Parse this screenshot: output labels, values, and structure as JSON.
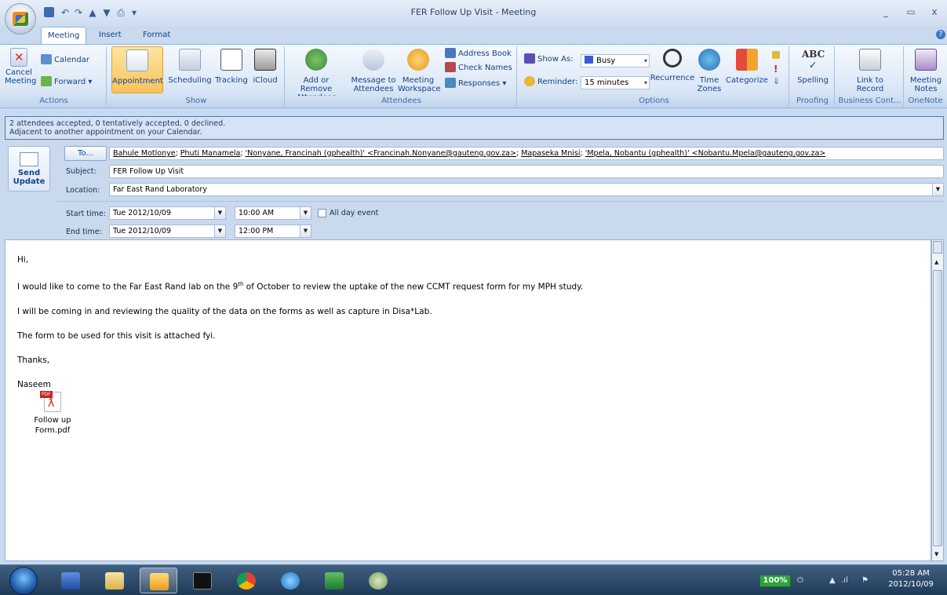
{
  "window": {
    "title": "FER Follow Up Visit - Meeting",
    "controls": [
      "_",
      "▭",
      "x"
    ]
  },
  "quick_access": [
    "save-icon",
    "undo-icon",
    "redo-icon",
    "up-icon",
    "down-icon",
    "print-icon",
    "customize-icon"
  ],
  "tabs": [
    "Meeting",
    "Insert",
    "Format Text"
  ],
  "ribbon": {
    "actions": {
      "cancel": "Cancel Meeting",
      "calendar": "Calendar",
      "forward": "Forward",
      "label": "Actions"
    },
    "show": {
      "appointment": "Appointment",
      "scheduling": "Scheduling",
      "tracking": "Tracking",
      "icloud": "iCloud",
      "label": "Show"
    },
    "attendees": {
      "add_remove": "Add or Remove Attendees",
      "message": "Message to Attendees",
      "workspace": "Meeting Workspace",
      "address_book": "Address Book",
      "check_names": "Check Names",
      "responses": "Responses",
      "label": "Attendees"
    },
    "options": {
      "show_as_label": "Show As:",
      "show_as_value": "Busy",
      "reminder_label": "Reminder:",
      "reminder_value": "15 minutes",
      "recurrence": "Recurrence",
      "time_zones": "Time Zones",
      "categorize": "Categorize",
      "label": "Options"
    },
    "proofing": {
      "spelling": "Spelling",
      "label": "Proofing"
    },
    "business": {
      "link": "Link to Record",
      "label": "Business Cont..."
    },
    "onenote": {
      "notes": "Meeting Notes",
      "label": "OneNote"
    }
  },
  "info": {
    "line1": "2 attendees accepted, 0 tentatively accepted, 0 declined.",
    "line2": "Adjacent to another appointment on your Calendar."
  },
  "form": {
    "send_update": "Send Update",
    "to_button": "To...",
    "recipients": [
      "Bahule Motlonye",
      "Phuti Manamela",
      "'Nonyane, Francinah (gphealth)' <Francinah.Nonyane@gauteng.gov.za>",
      "Mapaseka Mnisi",
      "'Mpela, Nobantu (gphealth)' <Nobantu.Mpela@gauteng.gov.za>"
    ],
    "subject_label": "Subject:",
    "subject": "FER Follow Up Visit",
    "location_label": "Location:",
    "location": "Far East Rand Laboratory",
    "start_label": "Start time:",
    "start_date": "Tue 2012/10/09",
    "start_time": "10:00 AM",
    "all_day": "All day event",
    "end_label": "End time:",
    "end_date": "Tue 2012/10/09",
    "end_time": "12:00 PM"
  },
  "body": {
    "greeting": "Hi,",
    "p1_before": "I would like to come to the Far East Rand lab on the 9",
    "p1_sup": "th",
    "p1_after": " of October to review the uptake of the new CCMT request form for my MPH study.",
    "p2": "I will be coming in and reviewing the quality of the data on the forms as well as capture in Disa*Lab.",
    "p3": "The form to be used for this visit is attached fyi.",
    "thanks": "Thanks,",
    "signature": "Naseem",
    "attachment_line1": "Follow up",
    "attachment_line2": "Form.pdf",
    "attachment_badge": "PDF"
  },
  "taskbar": {
    "battery": "100%",
    "time": "05:28 AM",
    "date": "2012/10/09"
  },
  "colors": {
    "accent": "#15428b",
    "ribbon_active": "#f7c35f",
    "busy": "#3b5bd6"
  }
}
